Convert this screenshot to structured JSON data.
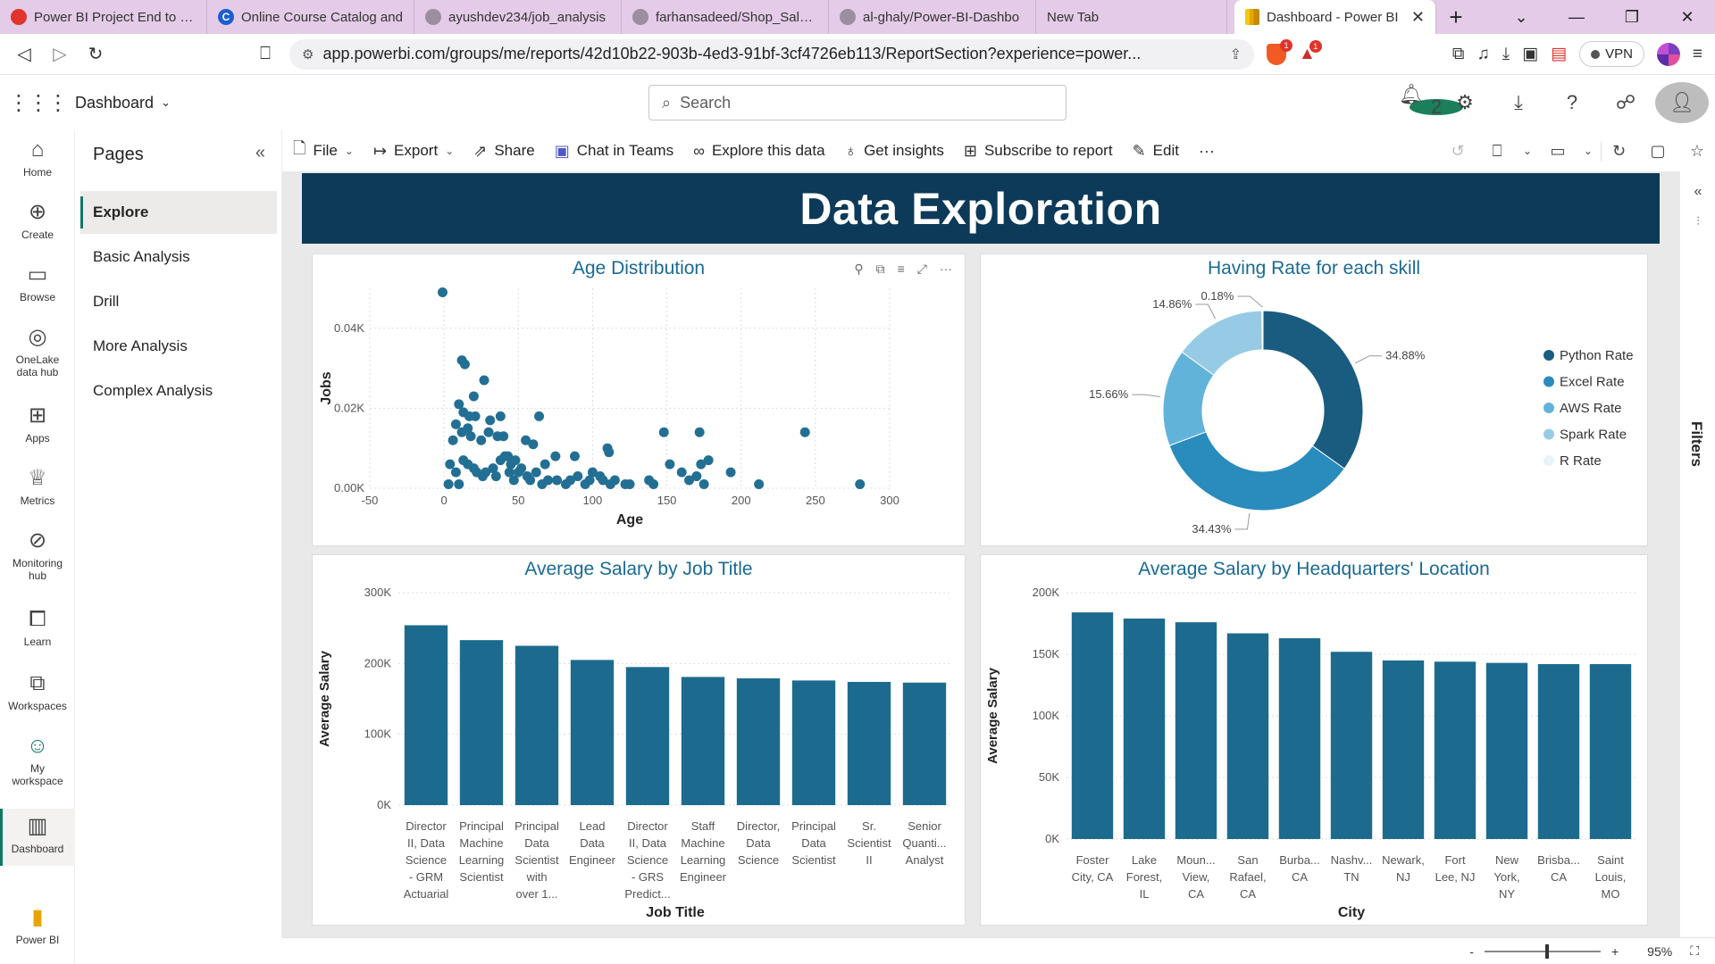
{
  "browser": {
    "tabs": [
      {
        "title": "Power BI Project End to End",
        "icon": "red-circle-icon"
      },
      {
        "title": "Online Course Catalog and",
        "icon": "coursera-icon"
      },
      {
        "title": "ayushdev234/job_analysis",
        "icon": "github-icon"
      },
      {
        "title": "farhansadeed/Shop_Sales_",
        "icon": "github-icon"
      },
      {
        "title": "al-ghaly/Power-BI-Dashbo",
        "icon": "github-icon"
      },
      {
        "title": "New Tab",
        "icon": ""
      }
    ],
    "active_tab": "Dashboard - Power BI",
    "url": "app.powerbi.com/groups/me/reports/42d10b22-903b-4ed3-91bf-3cf4726eb113/ReportSection?experience=power...",
    "vpn_label": "VPN",
    "brave_badge": "1",
    "alert_badge": "1"
  },
  "header": {
    "workspace": "Dashboard",
    "search_placeholder": "Search",
    "notification_count": "2"
  },
  "rail": [
    {
      "label": "Home",
      "icon": "home-icon"
    },
    {
      "label": "Create",
      "icon": "plus-circle-icon"
    },
    {
      "label": "Browse",
      "icon": "folder-icon"
    },
    {
      "label": "OneLake data hub",
      "icon": "onelake-icon"
    },
    {
      "label": "Apps",
      "icon": "apps-icon"
    },
    {
      "label": "Metrics",
      "icon": "trophy-icon"
    },
    {
      "label": "Monitoring hub",
      "icon": "monitor-icon"
    },
    {
      "label": "Learn",
      "icon": "book-icon"
    },
    {
      "label": "Workspaces",
      "icon": "workspaces-icon"
    },
    {
      "label": "My workspace",
      "icon": "person-icon"
    },
    {
      "label": "Dashboard",
      "icon": "report-icon"
    },
    {
      "label": "Power BI",
      "icon": "powerbi-logo-icon"
    }
  ],
  "pages": {
    "title": "Pages",
    "items": [
      "Explore",
      "Basic Analysis",
      "Drill",
      "More Analysis",
      "Complex Analysis"
    ],
    "selected": "Explore"
  },
  "actions": [
    {
      "label": "File",
      "icon": "file-icon",
      "dropdown": true
    },
    {
      "label": "Export",
      "icon": "export-icon",
      "dropdown": true
    },
    {
      "label": "Share",
      "icon": "share-icon",
      "dropdown": false
    },
    {
      "label": "Chat in Teams",
      "icon": "teams-icon",
      "dropdown": false
    },
    {
      "label": "Explore this data",
      "icon": "explore-icon",
      "dropdown": false
    },
    {
      "label": "Get insights",
      "icon": "lightbulb-icon",
      "dropdown": false
    },
    {
      "label": "Subscribe to report",
      "icon": "subscribe-icon",
      "dropdown": false
    },
    {
      "label": "Edit",
      "icon": "pencil-icon",
      "dropdown": false
    }
  ],
  "report": {
    "banner": "Data Exploration"
  },
  "filters_label": "Filters",
  "zoom": {
    "value": "95%",
    "minus": "-",
    "plus": "+"
  },
  "colors": {
    "banner_bg": "#0c3a58",
    "title": "#1a6a93",
    "bar": "#1c6b8e",
    "scatter": "#236f94",
    "donut": [
      "#1a5c7f",
      "#2a8bbd",
      "#62b3da",
      "#97cbe5",
      "#e8f3f9"
    ]
  },
  "chart_data": [
    {
      "type": "scatter",
      "title": "Age Distribution",
      "xlabel": "Age",
      "ylabel": "Jobs",
      "xlim": [
        -50,
        300
      ],
      "ylim": [
        0,
        0.05
      ],
      "xticks": [
        "-50",
        "0",
        "50",
        "100",
        "150",
        "200",
        "250",
        "300"
      ],
      "yticks": [
        "0.00K",
        "0.02K",
        "0.04K"
      ],
      "points": [
        [
          -1,
          0.049
        ],
        [
          12,
          0.032
        ],
        [
          14,
          0.031
        ],
        [
          27,
          0.027
        ],
        [
          20,
          0.023
        ],
        [
          10,
          0.021
        ],
        [
          13,
          0.019
        ],
        [
          17,
          0.018
        ],
        [
          21,
          0.018
        ],
        [
          38,
          0.018
        ],
        [
          64,
          0.018
        ],
        [
          8,
          0.016
        ],
        [
          12,
          0.014
        ],
        [
          6,
          0.012
        ],
        [
          18,
          0.013
        ],
        [
          25,
          0.012
        ],
        [
          30,
          0.014
        ],
        [
          36,
          0.013
        ],
        [
          40,
          0.013
        ],
        [
          41,
          0.008
        ],
        [
          43,
          0.008
        ],
        [
          48,
          0.007
        ],
        [
          60,
          0.011
        ],
        [
          55,
          0.012
        ],
        [
          68,
          0.006
        ],
        [
          75,
          0.008
        ],
        [
          88,
          0.008
        ],
        [
          110,
          0.01
        ],
        [
          111,
          0.009
        ],
        [
          148,
          0.014
        ],
        [
          172,
          0.014
        ],
        [
          243,
          0.014
        ],
        [
          4,
          0.006
        ],
        [
          8,
          0.004
        ],
        [
          13,
          0.007
        ],
        [
          16,
          0.006
        ],
        [
          20,
          0.005
        ],
        [
          22,
          0.004
        ],
        [
          26,
          0.003
        ],
        [
          28,
          0.004
        ],
        [
          33,
          0.005
        ],
        [
          35,
          0.003
        ],
        [
          44,
          0.004
        ],
        [
          47,
          0.002
        ],
        [
          50,
          0.004
        ],
        [
          52,
          0.005
        ],
        [
          56,
          0.003
        ],
        [
          58,
          0.002
        ],
        [
          62,
          0.004
        ],
        [
          70,
          0.002
        ],
        [
          76,
          0.002
        ],
        [
          82,
          0.001
        ],
        [
          85,
          0.002
        ],
        [
          90,
          0.003
        ],
        [
          95,
          0.001
        ],
        [
          98,
          0.002
        ],
        [
          100,
          0.004
        ],
        [
          105,
          0.003
        ],
        [
          107,
          0.002
        ],
        [
          112,
          0.001
        ],
        [
          115,
          0.002
        ],
        [
          122,
          0.001
        ],
        [
          125,
          0.001
        ],
        [
          138,
          0.002
        ],
        [
          141,
          0.001
        ],
        [
          152,
          0.006
        ],
        [
          160,
          0.004
        ],
        [
          165,
          0.002
        ],
        [
          170,
          0.003
        ],
        [
          173,
          0.006
        ],
        [
          175,
          0.001
        ],
        [
          178,
          0.007
        ],
        [
          193,
          0.004
        ],
        [
          212,
          0.001
        ],
        [
          280,
          0.001
        ],
        [
          45,
          0.006
        ],
        [
          38,
          0.007
        ],
        [
          16,
          0.015
        ],
        [
          31,
          0.017
        ],
        [
          10,
          0.001
        ],
        [
          3,
          0.001
        ],
        [
          66,
          0.001
        ]
      ]
    },
    {
      "type": "pie",
      "title": "Having Rate for each skill",
      "legend_position": "right",
      "slices": [
        {
          "name": "Python Rate",
          "value": 34.88,
          "label": "34.88%"
        },
        {
          "name": "Excel Rate",
          "value": 34.43,
          "label": "34.43%"
        },
        {
          "name": "AWS Rate",
          "value": 15.66,
          "label": "15.66%"
        },
        {
          "name": "Spark Rate",
          "value": 14.86,
          "label": "14.86%"
        },
        {
          "name": "R Rate",
          "value": 0.18,
          "label": "0.18%"
        }
      ]
    },
    {
      "type": "bar",
      "title": "Average Salary by Job Title",
      "xlabel": "Job Title",
      "ylabel": "Average Salary",
      "ylim": [
        0,
        300000
      ],
      "yticks": [
        "0K",
        "100K",
        "200K",
        "300K"
      ],
      "categories": [
        [
          "Director",
          "II, Data",
          "Science",
          "- GRM",
          "Actuarial"
        ],
        [
          "Principal",
          "Machine",
          "Learning",
          "Scientist"
        ],
        [
          "Principal",
          "Data",
          "Scientist",
          "with",
          "over 1..."
        ],
        [
          "Lead",
          "Data",
          "Engineer"
        ],
        [
          "Director",
          "II, Data",
          "Science",
          "- GRS",
          "Predict..."
        ],
        [
          "Staff",
          "Machine",
          "Learning",
          "Engineer"
        ],
        [
          "Director,",
          "Data",
          "Science"
        ],
        [
          "Principal",
          "Data",
          "Scientist"
        ],
        [
          "Sr.",
          "Scientist",
          "II"
        ],
        [
          "Senior",
          "Quanti...",
          "Analyst"
        ]
      ],
      "values": [
        254000,
        233000,
        225000,
        205000,
        195000,
        181000,
        179000,
        176000,
        174000,
        173000
      ]
    },
    {
      "type": "bar",
      "title": "Average Salary by Headquarters' Location",
      "xlabel": "City",
      "ylabel": "Average Salary",
      "ylim": [
        0,
        200000
      ],
      "yticks": [
        "0K",
        "50K",
        "100K",
        "150K",
        "200K"
      ],
      "categories": [
        [
          "Foster",
          "City, CA"
        ],
        [
          "Lake",
          "Forest,",
          "IL"
        ],
        [
          "Moun...",
          "View,",
          "CA"
        ],
        [
          "San",
          "Rafael,",
          "CA"
        ],
        [
          "Burba...",
          "CA"
        ],
        [
          "Nashv...",
          "TN"
        ],
        [
          "Newark,",
          "NJ"
        ],
        [
          "Fort",
          "Lee, NJ"
        ],
        [
          "New",
          "York,",
          "NY"
        ],
        [
          "Brisba...",
          "CA"
        ],
        [
          "Saint",
          "Louis,",
          "MO"
        ]
      ],
      "values": [
        184000,
        179000,
        176000,
        167000,
        163000,
        152000,
        145000,
        144000,
        143000,
        142000,
        142000
      ]
    }
  ]
}
